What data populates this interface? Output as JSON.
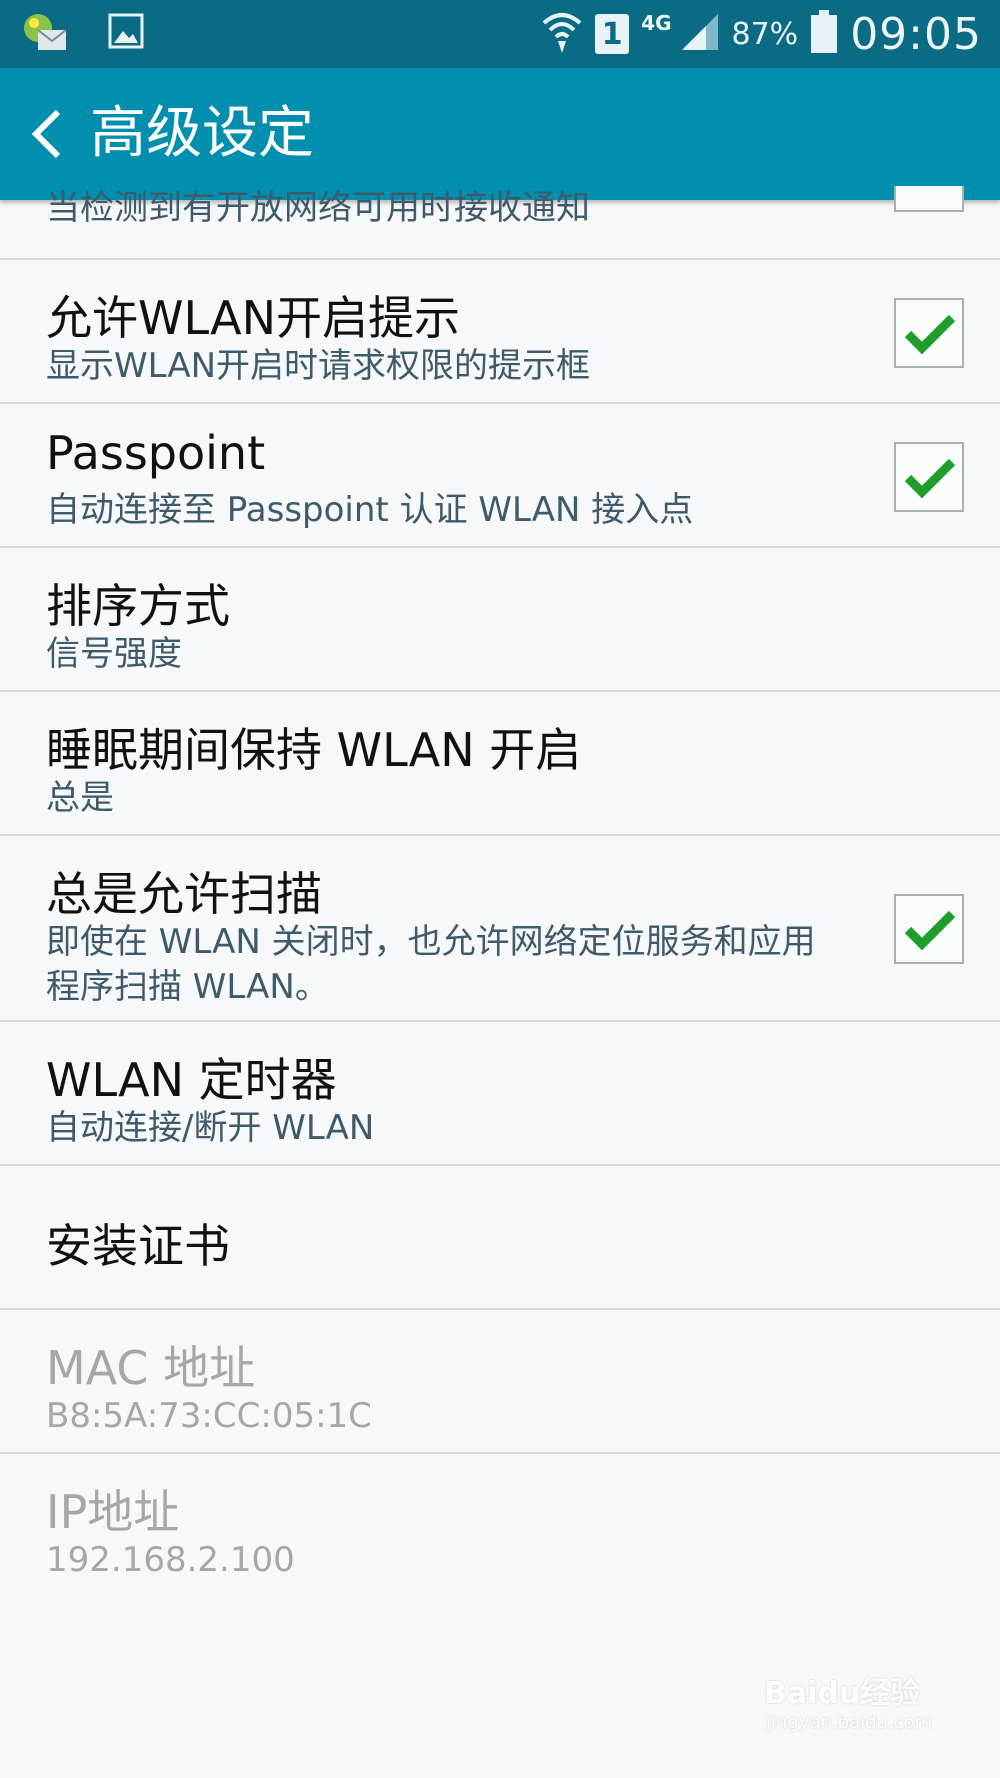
{
  "status_bar": {
    "left_icons": [
      "app-mail-notification-icon",
      "gallery-icon"
    ],
    "sim_slot": "1",
    "network": "4G",
    "battery_percent": "87%",
    "time": "09:05"
  },
  "app_bar": {
    "title": "高级设定",
    "back_icon": "chevron-left-icon",
    "background": "#028eae"
  },
  "items": [
    {
      "subtitle": "当检测到有开放网络可用时接收通知",
      "checkbox": true,
      "checked": false
    },
    {
      "title": "允许WLAN开启提示",
      "subtitle": "显示WLAN开启时请求权限的提示框",
      "checkbox": true,
      "checked": true
    },
    {
      "title": "Passpoint",
      "subtitle": "自动连接至 Passpoint 认证 WLAN 接入点",
      "checkbox": true,
      "checked": true
    },
    {
      "title": "排序方式",
      "subtitle": "信号强度"
    },
    {
      "title": "睡眠期间保持 WLAN 开启",
      "subtitle": "总是"
    },
    {
      "title": "总是允许扫描",
      "subtitle": "即使在 WLAN 关闭时，也允许网络定位服务和应用程序扫描 WLAN。",
      "checkbox": true,
      "checked": true
    },
    {
      "title": "WLAN 定时器",
      "subtitle": "自动连接/断开 WLAN"
    },
    {
      "title": "安装证书"
    },
    {
      "title": "MAC 地址",
      "subtitle": "B8:5A:73:CC:05:1C",
      "disabled": true
    },
    {
      "title": "IP地址",
      "subtitle": "192.168.2.100",
      "disabled": true
    }
  ],
  "watermark": {
    "text": "Baidu经验",
    "sub": "jingyan.baidu.com"
  },
  "colors": {
    "check": "#1f9e2b",
    "divider": "#d6d9dc",
    "subtitle": "#3f5a6a"
  }
}
